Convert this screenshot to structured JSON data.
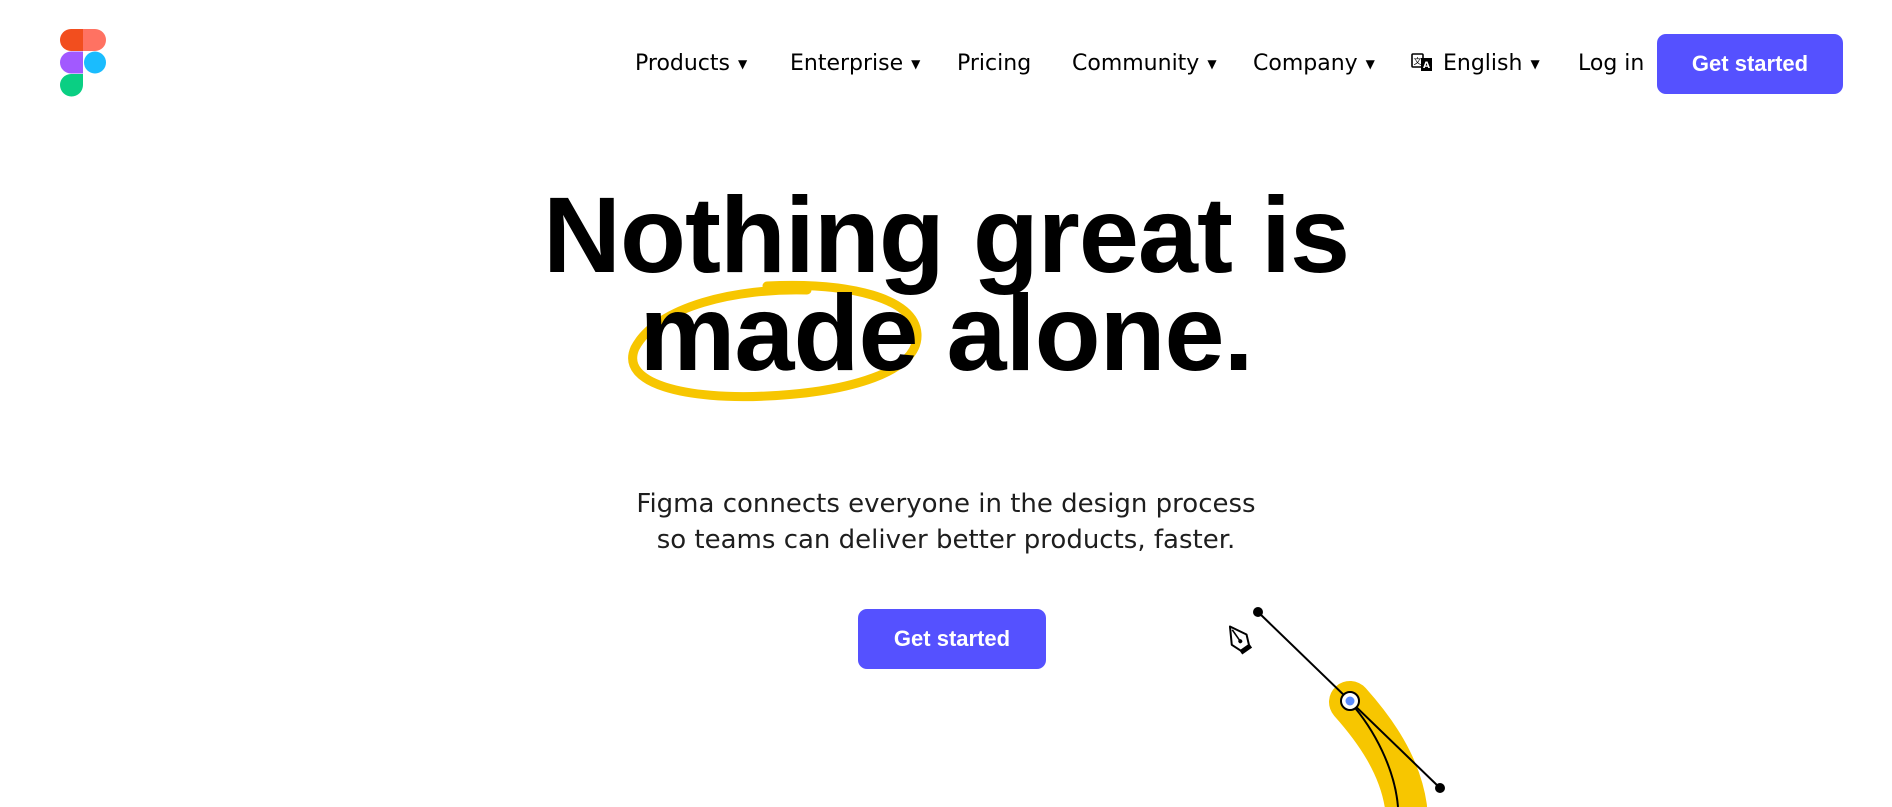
{
  "header": {
    "logo_icon": "figma-logo-icon",
    "nav": {
      "products": "Products",
      "enterprise": "Enterprise",
      "pricing": "Pricing",
      "community": "Community",
      "company": "Company",
      "language": "English",
      "login": "Log in",
      "cta": "Get started"
    },
    "language_icon": "translate-icon",
    "dropdown_icon": "caret-down-icon"
  },
  "hero": {
    "headline_line1": "Nothing great is",
    "headline_line2_circled": "made",
    "headline_line2_rest": " alone.",
    "subtitle_line1": "Figma connects everyone in the design process",
    "subtitle_line2": "so teams can deliver better products, faster.",
    "cta": "Get started",
    "illustration_icon": "pen-tool-icon"
  },
  "colors": {
    "brand_button": "#5551ff",
    "highlight_yellow": "#f7c600",
    "logo_red": "#f24e1e",
    "logo_orange": "#ff7262",
    "logo_purple": "#a259ff",
    "logo_blue": "#1abcfe",
    "logo_green": "#0acf83"
  }
}
